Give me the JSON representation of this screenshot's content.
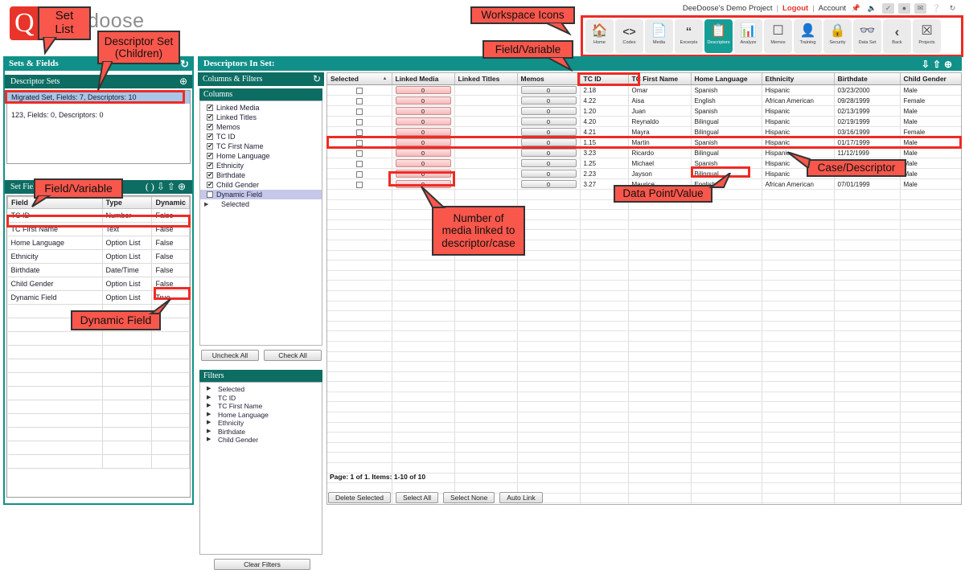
{
  "app": {
    "logo_text": "Dedoose",
    "logo_sub": "",
    "logo_glyph": "Q"
  },
  "account_bar": {
    "project": "DeeDoose's Demo Project",
    "separator": "|",
    "logout": "Logout",
    "account": "Account",
    "icons": [
      "pin-icon",
      "speaker-icon",
      "check-badge-icon",
      "bug-badge-icon",
      "mail-badge-icon",
      "help-icon",
      "refresh-icon"
    ]
  },
  "workspace": {
    "items": [
      {
        "label": "Home",
        "icon": "home-icon",
        "active": false
      },
      {
        "label": "Codes",
        "icon": "code-brackets-icon",
        "active": false
      },
      {
        "label": "Media",
        "icon": "media-document-icon",
        "active": false
      },
      {
        "label": "Excerpts",
        "icon": "quote-icon",
        "active": false
      },
      {
        "label": "Descriptors",
        "icon": "clipboard-icon",
        "active": true
      },
      {
        "label": "Analyze",
        "icon": "bar-chart-icon",
        "active": false
      },
      {
        "label": "Memos",
        "icon": "memo-icon",
        "active": false
      },
      {
        "label": "Training",
        "icon": "person-icon",
        "active": false
      },
      {
        "label": "Security",
        "icon": "lock-icon",
        "active": false
      },
      {
        "label": "Data Set",
        "icon": "glasses-icon",
        "active": false
      },
      {
        "label": "Back",
        "icon": "chevron-left-icon",
        "active": false
      },
      {
        "label": "Projects",
        "icon": "projects-box-icon",
        "active": false
      }
    ]
  },
  "left_panel": {
    "title": "Sets & Fields",
    "refresh_icon": "refresh-icon",
    "descriptor_sets": {
      "title": "Descriptor Sets",
      "add_icon": "plus-circle-icon",
      "rows": [
        {
          "label": "Migrated Set, Fields: 7, Descriptors: 10",
          "selected": true
        },
        {
          "label": "123, Fields: 0, Descriptors: 0",
          "selected": false
        }
      ]
    },
    "set_fields": {
      "title": "Set Fields",
      "icons": [
        "parens-icon",
        "download-icon",
        "upload-icon",
        "plus-circle-icon"
      ],
      "columns": [
        "Field",
        "Type",
        "Dynamic"
      ],
      "rows": [
        [
          "TC ID",
          "Number",
          "False"
        ],
        [
          "TC First Name",
          "Text",
          "False"
        ],
        [
          "Home Language",
          "Option List",
          "False"
        ],
        [
          "Ethnicity",
          "Option List",
          "False"
        ],
        [
          "Birthdate",
          "Date/Time",
          "False"
        ],
        [
          "Child Gender",
          "Option List",
          "False"
        ],
        [
          "Dynamic Field",
          "Option List",
          "True"
        ]
      ]
    }
  },
  "descriptors_panel": {
    "title": "Descriptors In Set:",
    "icons": [
      "download-icon",
      "upload-icon",
      "plus-circle-icon"
    ]
  },
  "columns_filters": {
    "title": "Columns & Filters",
    "refresh_icon": "refresh-icon",
    "columns_title": "Columns",
    "columns": [
      {
        "label": "Linked Media",
        "checked": true,
        "selected": false
      },
      {
        "label": "Linked Titles",
        "checked": true,
        "selected": false
      },
      {
        "label": "Memos",
        "checked": true,
        "selected": false
      },
      {
        "label": "TC ID",
        "checked": true,
        "selected": false
      },
      {
        "label": "TC First Name",
        "checked": true,
        "selected": false
      },
      {
        "label": "Home Language",
        "checked": true,
        "selected": false
      },
      {
        "label": "Ethnicity",
        "checked": true,
        "selected": false
      },
      {
        "label": "Birthdate",
        "checked": true,
        "selected": false
      },
      {
        "label": "Child Gender",
        "checked": true,
        "selected": false
      },
      {
        "label": "Dynamic Field",
        "checked": false,
        "selected": true
      }
    ],
    "tree_item": "Selected",
    "uncheck_all": "Uncheck All",
    "check_all": "Check All",
    "filters_title": "Filters",
    "filters": [
      "Selected",
      "TC ID",
      "TC First Name",
      "Home Language",
      "Ethnicity",
      "Birthdate",
      "Child Gender"
    ],
    "clear_filters": "Clear Filters"
  },
  "table": {
    "columns": [
      "Selected",
      "Linked Media",
      "Linked Titles",
      "Memos",
      "TC ID",
      "TC First Name",
      "Home Language",
      "Ethnicity",
      "Birthdate",
      "Child Gender"
    ],
    "sorted_column": "Selected",
    "sort_direction": "asc",
    "rows": [
      {
        "selected": false,
        "linked_media": "0",
        "linked_titles": "",
        "memos": "0",
        "tc_id": "2.18",
        "first_name": "Omar",
        "home_language": "Spanish",
        "ethnicity": "Hispanic",
        "birthdate": "03/23/2000",
        "gender": "Male"
      },
      {
        "selected": false,
        "linked_media": "0",
        "linked_titles": "",
        "memos": "0",
        "tc_id": "4.22",
        "first_name": "Aisa",
        "home_language": "English",
        "ethnicity": "African American",
        "birthdate": "09/28/1999",
        "gender": "Female"
      },
      {
        "selected": false,
        "linked_media": "0",
        "linked_titles": "",
        "memos": "0",
        "tc_id": "1.20",
        "first_name": "Juan",
        "home_language": "Spanish",
        "ethnicity": "Hispanic",
        "birthdate": "02/13/1999",
        "gender": "Male"
      },
      {
        "selected": false,
        "linked_media": "0",
        "linked_titles": "",
        "memos": "0",
        "tc_id": "4.20",
        "first_name": "Reynaldo",
        "home_language": "Bilingual",
        "ethnicity": "Hispanic",
        "birthdate": "02/19/1999",
        "gender": "Male"
      },
      {
        "selected": false,
        "linked_media": "0",
        "linked_titles": "",
        "memos": "0",
        "tc_id": "4.21",
        "first_name": "Mayra",
        "home_language": "Bilingual",
        "ethnicity": "Hispanic",
        "birthdate": "03/16/1999",
        "gender": "Female"
      },
      {
        "selected": false,
        "linked_media": "0",
        "linked_titles": "",
        "memos": "0",
        "tc_id": "1.15",
        "first_name": "Martin",
        "home_language": "Spanish",
        "ethnicity": "Hispanic",
        "birthdate": "01/17/1999",
        "gender": "Male"
      },
      {
        "selected": false,
        "linked_media": "0",
        "linked_titles": "",
        "memos": "0",
        "tc_id": "3.23",
        "first_name": "Ricardo",
        "home_language": "Bilingual",
        "ethnicity": "Hispanic",
        "birthdate": "11/12/1999",
        "gender": "Male"
      },
      {
        "selected": false,
        "linked_media": "0",
        "linked_titles": "",
        "memos": "0",
        "tc_id": "1.25",
        "first_name": "Michael",
        "home_language": "Spanish",
        "ethnicity": "Hispanic",
        "birthdate": "",
        "gender": "Male"
      },
      {
        "selected": false,
        "linked_media": "0",
        "linked_titles": "",
        "memos": "0",
        "tc_id": "2.23",
        "first_name": "Jayson",
        "home_language": "Bilingual",
        "ethnicity": "Hispanic",
        "birthdate": "",
        "gender": "Male"
      },
      {
        "selected": false,
        "linked_media": "0",
        "linked_titles": "",
        "memos": "0",
        "tc_id": "3.27",
        "first_name": "Maurice",
        "home_language": "English",
        "ethnicity": "African American",
        "birthdate": "07/01/1999",
        "gender": "Male"
      }
    ],
    "page_info": "Page: 1 of 1. Items: 1-10 of 10",
    "buttons": [
      "Delete Selected",
      "Select All",
      "Select None",
      "Auto Link"
    ]
  },
  "annotations": [
    {
      "id": "set-list",
      "text": "Set\nList"
    },
    {
      "id": "descriptor-set-children",
      "text": "Descriptor Set\n(Children)"
    },
    {
      "id": "field-variable-left",
      "text": "Field/Variable"
    },
    {
      "id": "dynamic-field",
      "text": "Dynamic Field"
    },
    {
      "id": "workspace-icons",
      "text": "Workspace Icons"
    },
    {
      "id": "field-variable-top",
      "text": "Field/Variable"
    },
    {
      "id": "case-descriptor",
      "text": "Case/Descriptor"
    },
    {
      "id": "data-point-value",
      "text": "Data Point/Value"
    },
    {
      "id": "number-of-media",
      "text": "Number of\nmedia linked to\ndescriptor/case"
    }
  ],
  "colors": {
    "brand_red": "#e8342a",
    "teal_header": "#109088",
    "teal_dark": "#0d6d63",
    "annotation_fill": "#f9574c",
    "annotation_border": "#ee2b24"
  }
}
